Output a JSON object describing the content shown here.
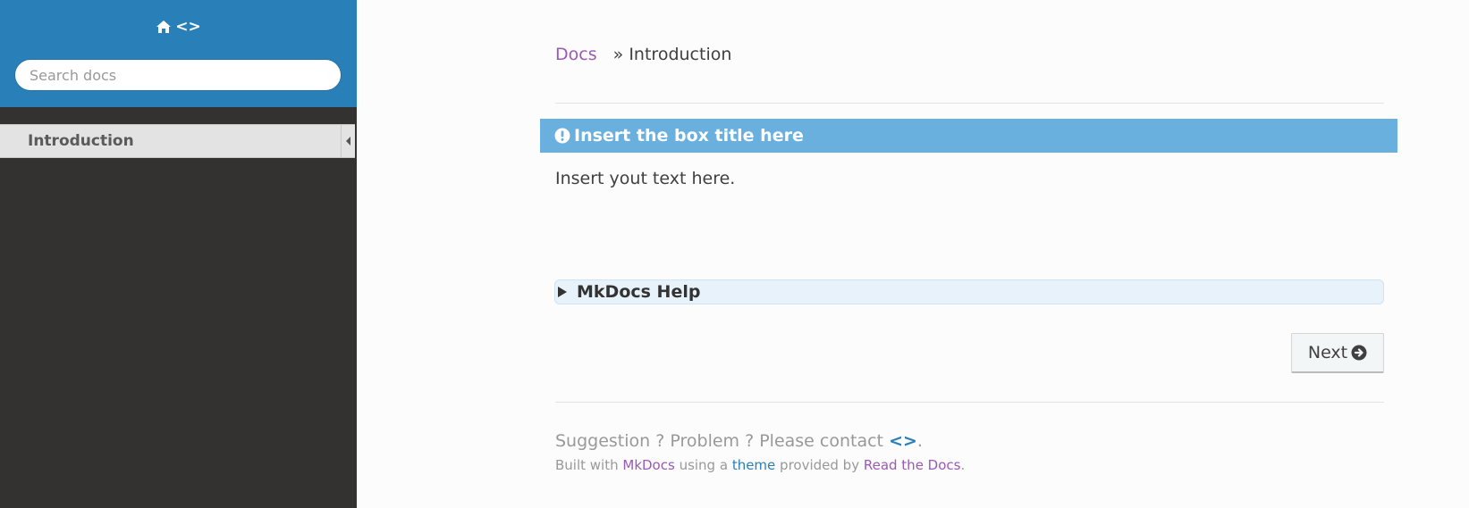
{
  "sidebar": {
    "home_text": "<>",
    "search_placeholder": "Search docs",
    "nav_items": [
      {
        "label": "Introduction",
        "active": true
      }
    ]
  },
  "breadcrumb": {
    "root": "Docs",
    "separator": "»",
    "current": "Introduction"
  },
  "admonition": {
    "title": "Insert the box title here",
    "icon": "exclamation-circle-icon"
  },
  "content": {
    "text": "Insert yout text here."
  },
  "details": {
    "summary": "MkDocs Help"
  },
  "navigation": {
    "next_label": "Next"
  },
  "footer": {
    "line1_prefix": "Suggestion ? Problem ? Please contact ",
    "contact": "<>",
    "line1_suffix": ".",
    "built_with": "Built with ",
    "mkdocs": "MkDocs",
    "using_a": " using a ",
    "theme": "theme",
    "provided_by": " provided by ",
    "rtd": "Read the Docs",
    "end": "."
  },
  "colors": {
    "sidebar_top": "#2980b9",
    "sidebar_bg": "#343131",
    "admonition_title_bg": "#6ab0de",
    "link_purple": "#9b59b6",
    "link_blue": "#2980b9"
  }
}
